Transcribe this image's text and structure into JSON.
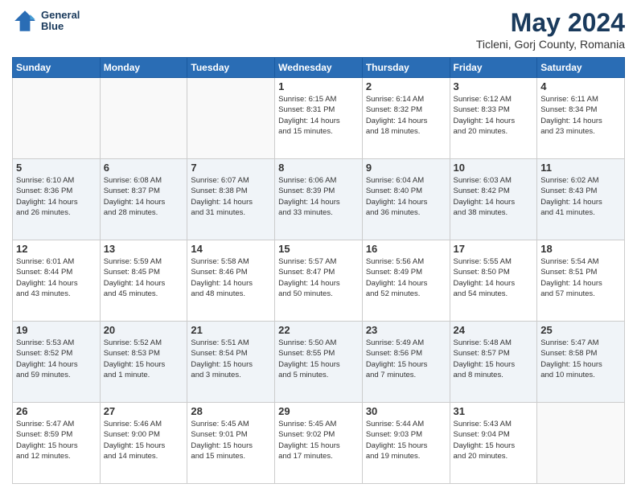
{
  "header": {
    "logo_line1": "General",
    "logo_line2": "Blue",
    "month_year": "May 2024",
    "location": "Ticleni, Gorj County, Romania"
  },
  "days_of_week": [
    "Sunday",
    "Monday",
    "Tuesday",
    "Wednesday",
    "Thursday",
    "Friday",
    "Saturday"
  ],
  "weeks": [
    {
      "stripe": false,
      "days": [
        {
          "num": "",
          "detail": ""
        },
        {
          "num": "",
          "detail": ""
        },
        {
          "num": "",
          "detail": ""
        },
        {
          "num": "1",
          "detail": "Sunrise: 6:15 AM\nSunset: 8:31 PM\nDaylight: 14 hours\nand 15 minutes."
        },
        {
          "num": "2",
          "detail": "Sunrise: 6:14 AM\nSunset: 8:32 PM\nDaylight: 14 hours\nand 18 minutes."
        },
        {
          "num": "3",
          "detail": "Sunrise: 6:12 AM\nSunset: 8:33 PM\nDaylight: 14 hours\nand 20 minutes."
        },
        {
          "num": "4",
          "detail": "Sunrise: 6:11 AM\nSunset: 8:34 PM\nDaylight: 14 hours\nand 23 minutes."
        }
      ]
    },
    {
      "stripe": true,
      "days": [
        {
          "num": "5",
          "detail": "Sunrise: 6:10 AM\nSunset: 8:36 PM\nDaylight: 14 hours\nand 26 minutes."
        },
        {
          "num": "6",
          "detail": "Sunrise: 6:08 AM\nSunset: 8:37 PM\nDaylight: 14 hours\nand 28 minutes."
        },
        {
          "num": "7",
          "detail": "Sunrise: 6:07 AM\nSunset: 8:38 PM\nDaylight: 14 hours\nand 31 minutes."
        },
        {
          "num": "8",
          "detail": "Sunrise: 6:06 AM\nSunset: 8:39 PM\nDaylight: 14 hours\nand 33 minutes."
        },
        {
          "num": "9",
          "detail": "Sunrise: 6:04 AM\nSunset: 8:40 PM\nDaylight: 14 hours\nand 36 minutes."
        },
        {
          "num": "10",
          "detail": "Sunrise: 6:03 AM\nSunset: 8:42 PM\nDaylight: 14 hours\nand 38 minutes."
        },
        {
          "num": "11",
          "detail": "Sunrise: 6:02 AM\nSunset: 8:43 PM\nDaylight: 14 hours\nand 41 minutes."
        }
      ]
    },
    {
      "stripe": false,
      "days": [
        {
          "num": "12",
          "detail": "Sunrise: 6:01 AM\nSunset: 8:44 PM\nDaylight: 14 hours\nand 43 minutes."
        },
        {
          "num": "13",
          "detail": "Sunrise: 5:59 AM\nSunset: 8:45 PM\nDaylight: 14 hours\nand 45 minutes."
        },
        {
          "num": "14",
          "detail": "Sunrise: 5:58 AM\nSunset: 8:46 PM\nDaylight: 14 hours\nand 48 minutes."
        },
        {
          "num": "15",
          "detail": "Sunrise: 5:57 AM\nSunset: 8:47 PM\nDaylight: 14 hours\nand 50 minutes."
        },
        {
          "num": "16",
          "detail": "Sunrise: 5:56 AM\nSunset: 8:49 PM\nDaylight: 14 hours\nand 52 minutes."
        },
        {
          "num": "17",
          "detail": "Sunrise: 5:55 AM\nSunset: 8:50 PM\nDaylight: 14 hours\nand 54 minutes."
        },
        {
          "num": "18",
          "detail": "Sunrise: 5:54 AM\nSunset: 8:51 PM\nDaylight: 14 hours\nand 57 minutes."
        }
      ]
    },
    {
      "stripe": true,
      "days": [
        {
          "num": "19",
          "detail": "Sunrise: 5:53 AM\nSunset: 8:52 PM\nDaylight: 14 hours\nand 59 minutes."
        },
        {
          "num": "20",
          "detail": "Sunrise: 5:52 AM\nSunset: 8:53 PM\nDaylight: 15 hours\nand 1 minute."
        },
        {
          "num": "21",
          "detail": "Sunrise: 5:51 AM\nSunset: 8:54 PM\nDaylight: 15 hours\nand 3 minutes."
        },
        {
          "num": "22",
          "detail": "Sunrise: 5:50 AM\nSunset: 8:55 PM\nDaylight: 15 hours\nand 5 minutes."
        },
        {
          "num": "23",
          "detail": "Sunrise: 5:49 AM\nSunset: 8:56 PM\nDaylight: 15 hours\nand 7 minutes."
        },
        {
          "num": "24",
          "detail": "Sunrise: 5:48 AM\nSunset: 8:57 PM\nDaylight: 15 hours\nand 8 minutes."
        },
        {
          "num": "25",
          "detail": "Sunrise: 5:47 AM\nSunset: 8:58 PM\nDaylight: 15 hours\nand 10 minutes."
        }
      ]
    },
    {
      "stripe": false,
      "days": [
        {
          "num": "26",
          "detail": "Sunrise: 5:47 AM\nSunset: 8:59 PM\nDaylight: 15 hours\nand 12 minutes."
        },
        {
          "num": "27",
          "detail": "Sunrise: 5:46 AM\nSunset: 9:00 PM\nDaylight: 15 hours\nand 14 minutes."
        },
        {
          "num": "28",
          "detail": "Sunrise: 5:45 AM\nSunset: 9:01 PM\nDaylight: 15 hours\nand 15 minutes."
        },
        {
          "num": "29",
          "detail": "Sunrise: 5:45 AM\nSunset: 9:02 PM\nDaylight: 15 hours\nand 17 minutes."
        },
        {
          "num": "30",
          "detail": "Sunrise: 5:44 AM\nSunset: 9:03 PM\nDaylight: 15 hours\nand 19 minutes."
        },
        {
          "num": "31",
          "detail": "Sunrise: 5:43 AM\nSunset: 9:04 PM\nDaylight: 15 hours\nand 20 minutes."
        },
        {
          "num": "",
          "detail": ""
        }
      ]
    }
  ]
}
